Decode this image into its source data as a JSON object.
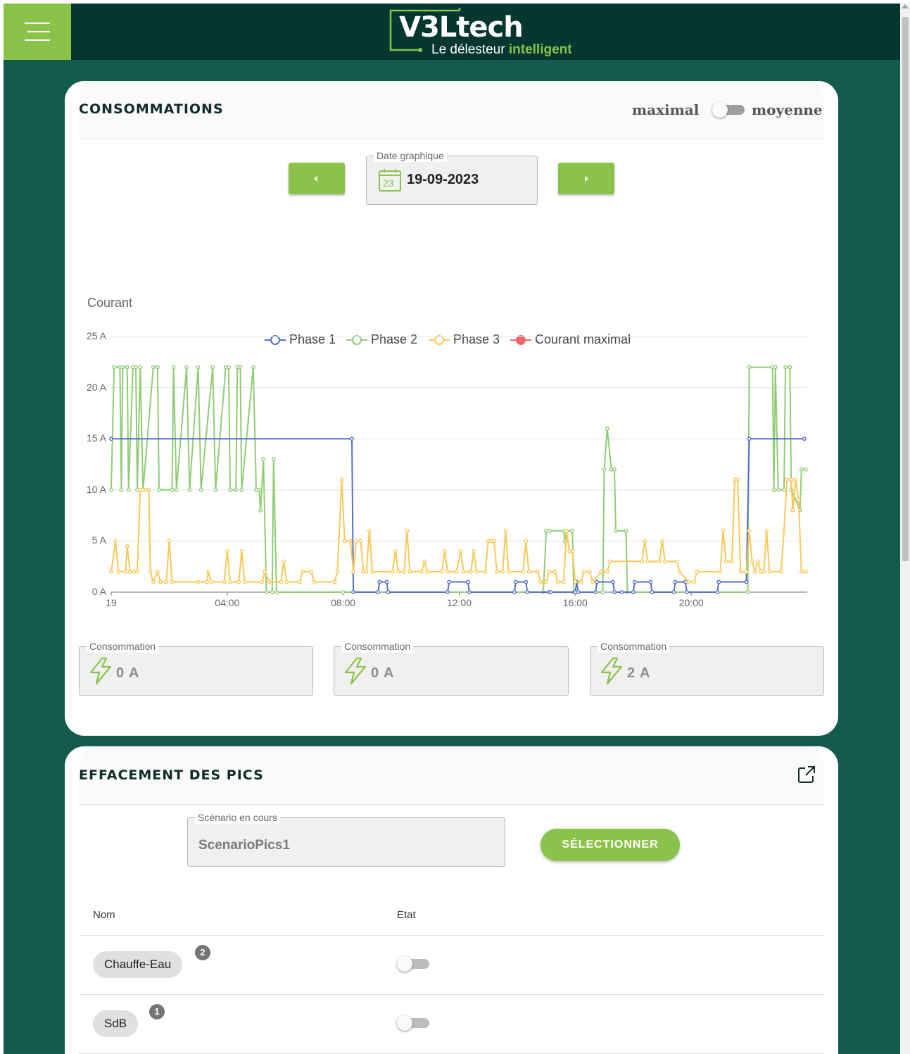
{
  "header": {
    "logo_main": "V3Ltech",
    "logo_tagline_part1": "Le délesteur",
    "logo_tagline_part2": "intelligent",
    "menu_icon": "hamburger-menu-icon"
  },
  "consommations": {
    "title": "CONSOMMATIONS",
    "toggle_left_label": "maximal",
    "toggle_right_label": "moyenne",
    "toggle_state": "maximal",
    "date_field_label": "Date graphique",
    "date_value": "19-09-2023",
    "calendar_day": "23",
    "legend": [
      {
        "name": "Phase 1",
        "color": "#5470c6"
      },
      {
        "name": "Phase 2",
        "color": "#91cc75"
      },
      {
        "name": "Phase 3",
        "color": "#fac858"
      },
      {
        "name": "Courant maximal",
        "color": "#ee6666"
      }
    ],
    "cards": [
      {
        "label": "Consommation",
        "value": "0 A"
      },
      {
        "label": "Consommation",
        "value": "0 A"
      },
      {
        "label": "Consommation",
        "value": "2 A"
      }
    ]
  },
  "chart_data": {
    "type": "line",
    "ylabel": "Courant",
    "ytick_labels": [
      "0 A",
      "5 A",
      "10 A",
      "15 A",
      "20 A",
      "25 A"
    ],
    "ylim": [
      0,
      25
    ],
    "xtick_labels": [
      "19",
      "04:00",
      "08:00",
      "12:00",
      "16:00",
      "20:00"
    ],
    "x_ticks_hours": [
      0,
      4,
      8,
      12,
      16,
      20
    ],
    "xlim_hours": [
      0,
      24
    ],
    "grid": true,
    "legend_position": "top-center",
    "series": [
      {
        "name": "Phase 1",
        "color": "#5470c6",
        "points": [
          [
            0,
            15
          ],
          [
            8.3,
            15
          ],
          [
            8.35,
            0
          ],
          [
            9.2,
            0
          ],
          [
            9.25,
            1
          ],
          [
            9.5,
            1
          ],
          [
            9.55,
            0
          ],
          [
            11.6,
            0
          ],
          [
            11.65,
            1
          ],
          [
            12.3,
            1
          ],
          [
            12.35,
            0
          ],
          [
            13.9,
            0
          ],
          [
            13.95,
            1
          ],
          [
            14.3,
            1
          ],
          [
            14.35,
            0
          ],
          [
            15.1,
            0
          ],
          [
            15.15,
            0
          ],
          [
            16,
            0
          ],
          [
            16.05,
            1
          ],
          [
            16.1,
            0
          ],
          [
            16.7,
            0
          ],
          [
            16.75,
            1
          ],
          [
            17.3,
            1
          ],
          [
            17.35,
            0
          ],
          [
            17.6,
            0
          ],
          [
            18,
            0
          ],
          [
            18.05,
            1
          ],
          [
            18.6,
            1
          ],
          [
            18.65,
            0
          ],
          [
            19.4,
            0
          ],
          [
            19.45,
            1
          ],
          [
            19.8,
            1
          ],
          [
            19.85,
            0
          ],
          [
            20.9,
            0
          ],
          [
            20.95,
            1
          ],
          [
            21.9,
            1
          ],
          [
            22,
            15
          ],
          [
            23.9,
            15
          ]
        ]
      },
      {
        "name": "Phase 2",
        "color": "#91cc75",
        "points": [
          [
            0,
            10
          ],
          [
            0.1,
            22
          ],
          [
            0.3,
            22
          ],
          [
            0.35,
            10
          ],
          [
            0.4,
            22
          ],
          [
            0.55,
            22
          ],
          [
            0.6,
            10
          ],
          [
            0.75,
            22
          ],
          [
            0.85,
            22
          ],
          [
            0.9,
            10
          ],
          [
            1,
            22
          ],
          [
            1.1,
            10
          ],
          [
            1.45,
            22
          ],
          [
            1.6,
            22
          ],
          [
            1.65,
            10
          ],
          [
            2.1,
            10
          ],
          [
            2.15,
            22
          ],
          [
            2.25,
            10
          ],
          [
            2.6,
            22
          ],
          [
            2.7,
            10
          ],
          [
            3,
            22
          ],
          [
            3.1,
            10
          ],
          [
            3.5,
            22
          ],
          [
            3.6,
            10
          ],
          [
            3.95,
            22
          ],
          [
            4.05,
            22
          ],
          [
            4.1,
            10
          ],
          [
            4.3,
            10
          ],
          [
            4.35,
            22
          ],
          [
            4.45,
            22
          ],
          [
            4.5,
            10
          ],
          [
            4.9,
            22
          ],
          [
            5,
            10
          ],
          [
            5.1,
            10
          ],
          [
            5.15,
            8
          ],
          [
            5.25,
            13
          ],
          [
            5.35,
            0
          ],
          [
            5.55,
            0
          ],
          [
            5.6,
            13
          ],
          [
            5.7,
            0
          ],
          [
            8,
            0
          ],
          [
            14.9,
            0
          ],
          [
            15,
            6
          ],
          [
            15.1,
            6
          ],
          [
            15.6,
            6
          ],
          [
            15.65,
            5
          ],
          [
            15.7,
            6
          ],
          [
            15.9,
            6
          ],
          [
            15.95,
            0
          ],
          [
            16.95,
            0
          ],
          [
            17,
            12
          ],
          [
            17.1,
            16
          ],
          [
            17.25,
            12
          ],
          [
            17.35,
            12
          ],
          [
            17.4,
            6
          ],
          [
            17.75,
            6
          ],
          [
            17.8,
            0
          ],
          [
            18,
            0
          ],
          [
            21.95,
            0
          ],
          [
            22,
            22
          ],
          [
            22.8,
            22
          ],
          [
            22.85,
            10
          ],
          [
            22.9,
            22
          ],
          [
            23,
            10
          ],
          [
            23.2,
            10
          ],
          [
            23.25,
            22
          ],
          [
            23.4,
            22
          ],
          [
            23.45,
            10
          ],
          [
            23.75,
            8
          ],
          [
            23.8,
            12
          ],
          [
            23.95,
            12
          ]
        ]
      },
      {
        "name": "Phase 3",
        "color": "#fac858",
        "points": [
          [
            0,
            2
          ],
          [
            0.15,
            5
          ],
          [
            0.25,
            2
          ],
          [
            0.5,
            2
          ],
          [
            0.55,
            4.5
          ],
          [
            0.65,
            2
          ],
          [
            0.8,
            2
          ],
          [
            0.9,
            2
          ],
          [
            1,
            10
          ],
          [
            1.1,
            10
          ],
          [
            1.2,
            10
          ],
          [
            1.3,
            10
          ],
          [
            1.35,
            2
          ],
          [
            1.45,
            1
          ],
          [
            1.6,
            2
          ],
          [
            1.7,
            1
          ],
          [
            1.9,
            1
          ],
          [
            2,
            5
          ],
          [
            2.1,
            1
          ],
          [
            3,
            1
          ],
          [
            3.3,
            1
          ],
          [
            3.35,
            2
          ],
          [
            3.45,
            1
          ],
          [
            3.9,
            1
          ],
          [
            4,
            4
          ],
          [
            4.1,
            1
          ],
          [
            4.4,
            1
          ],
          [
            4.5,
            4
          ],
          [
            4.6,
            1
          ],
          [
            5.2,
            1
          ],
          [
            5.3,
            2
          ],
          [
            5.45,
            1
          ],
          [
            5.85,
            1
          ],
          [
            5.95,
            3
          ],
          [
            6.05,
            1
          ],
          [
            6.5,
            1
          ],
          [
            6.6,
            2
          ],
          [
            6.9,
            2
          ],
          [
            7,
            1
          ],
          [
            7.7,
            1
          ],
          [
            7.8,
            2
          ],
          [
            7.95,
            11
          ],
          [
            8.05,
            5
          ],
          [
            8.25,
            5
          ],
          [
            8.35,
            2
          ],
          [
            8.45,
            5
          ],
          [
            8.6,
            5
          ],
          [
            8.7,
            2
          ],
          [
            8.8,
            2
          ],
          [
            8.9,
            6
          ],
          [
            9,
            2
          ],
          [
            9.7,
            2
          ],
          [
            9.8,
            4
          ],
          [
            9.9,
            2
          ],
          [
            10.1,
            2
          ],
          [
            10.2,
            6
          ],
          [
            10.3,
            2
          ],
          [
            10.7,
            2
          ],
          [
            10.8,
            3
          ],
          [
            10.9,
            2
          ],
          [
            11.4,
            2
          ],
          [
            11.5,
            4
          ],
          [
            11.6,
            2
          ],
          [
            11.9,
            2
          ],
          [
            12.05,
            4
          ],
          [
            12.15,
            2
          ],
          [
            12.4,
            2
          ],
          [
            12.5,
            4
          ],
          [
            12.6,
            2
          ],
          [
            12.9,
            2
          ],
          [
            13,
            5
          ],
          [
            13.1,
            5
          ],
          [
            13.2,
            5
          ],
          [
            13.3,
            2
          ],
          [
            13.5,
            2
          ],
          [
            13.6,
            6
          ],
          [
            13.7,
            2
          ],
          [
            14.2,
            2
          ],
          [
            14.3,
            5
          ],
          [
            14.4,
            2
          ],
          [
            14.7,
            2
          ],
          [
            14.8,
            1
          ],
          [
            15,
            1
          ],
          [
            15.1,
            2
          ],
          [
            15.3,
            2
          ],
          [
            15.4,
            1
          ],
          [
            15.6,
            1
          ],
          [
            15.7,
            6
          ],
          [
            15.8,
            4
          ],
          [
            15.9,
            4
          ],
          [
            16,
            1
          ],
          [
            16.2,
            1
          ],
          [
            16.3,
            2
          ],
          [
            16.5,
            2
          ],
          [
            16.6,
            1
          ],
          [
            16.9,
            2
          ],
          [
            17.1,
            2
          ],
          [
            17.2,
            3
          ],
          [
            18.3,
            3
          ],
          [
            18.4,
            5
          ],
          [
            18.5,
            3
          ],
          [
            18.9,
            3
          ],
          [
            19,
            5
          ],
          [
            19.1,
            3
          ],
          [
            19.5,
            3
          ],
          [
            19.6,
            2
          ],
          [
            19.9,
            1
          ],
          [
            20.1,
            1
          ],
          [
            20.2,
            2
          ],
          [
            21,
            2
          ],
          [
            21.1,
            6
          ],
          [
            21.2,
            3
          ],
          [
            21.4,
            3
          ],
          [
            21.5,
            11
          ],
          [
            21.6,
            11
          ],
          [
            21.7,
            2
          ],
          [
            21.9,
            2
          ],
          [
            22,
            6
          ],
          [
            22.1,
            3
          ],
          [
            22.2,
            2
          ],
          [
            22.3,
            3
          ],
          [
            22.4,
            2
          ],
          [
            22.5,
            2
          ],
          [
            22.6,
            6
          ],
          [
            22.7,
            2
          ],
          [
            23.1,
            2
          ],
          [
            23.2,
            6
          ],
          [
            23.3,
            11
          ],
          [
            23.45,
            11
          ],
          [
            23.5,
            8
          ],
          [
            23.6,
            11
          ],
          [
            23.7,
            9
          ],
          [
            23.8,
            2
          ],
          [
            23.95,
            2
          ]
        ]
      },
      {
        "name": "Courant maximal",
        "color": "#ee6666",
        "points": []
      }
    ]
  },
  "effacement": {
    "title": "EFFACEMENT DES PICS",
    "external_link_icon": "external-link-icon",
    "scenario_label": "Scénario en cours",
    "scenario_value": "ScenarioPics1",
    "select_button": "SÉLECTIONNER",
    "columns": [
      "Nom",
      "Etat"
    ],
    "rows": [
      {
        "name": "Chauffe-Eau",
        "badge": "2",
        "state": "off"
      },
      {
        "name": "SdB",
        "badge": "1",
        "state": "off"
      }
    ]
  }
}
